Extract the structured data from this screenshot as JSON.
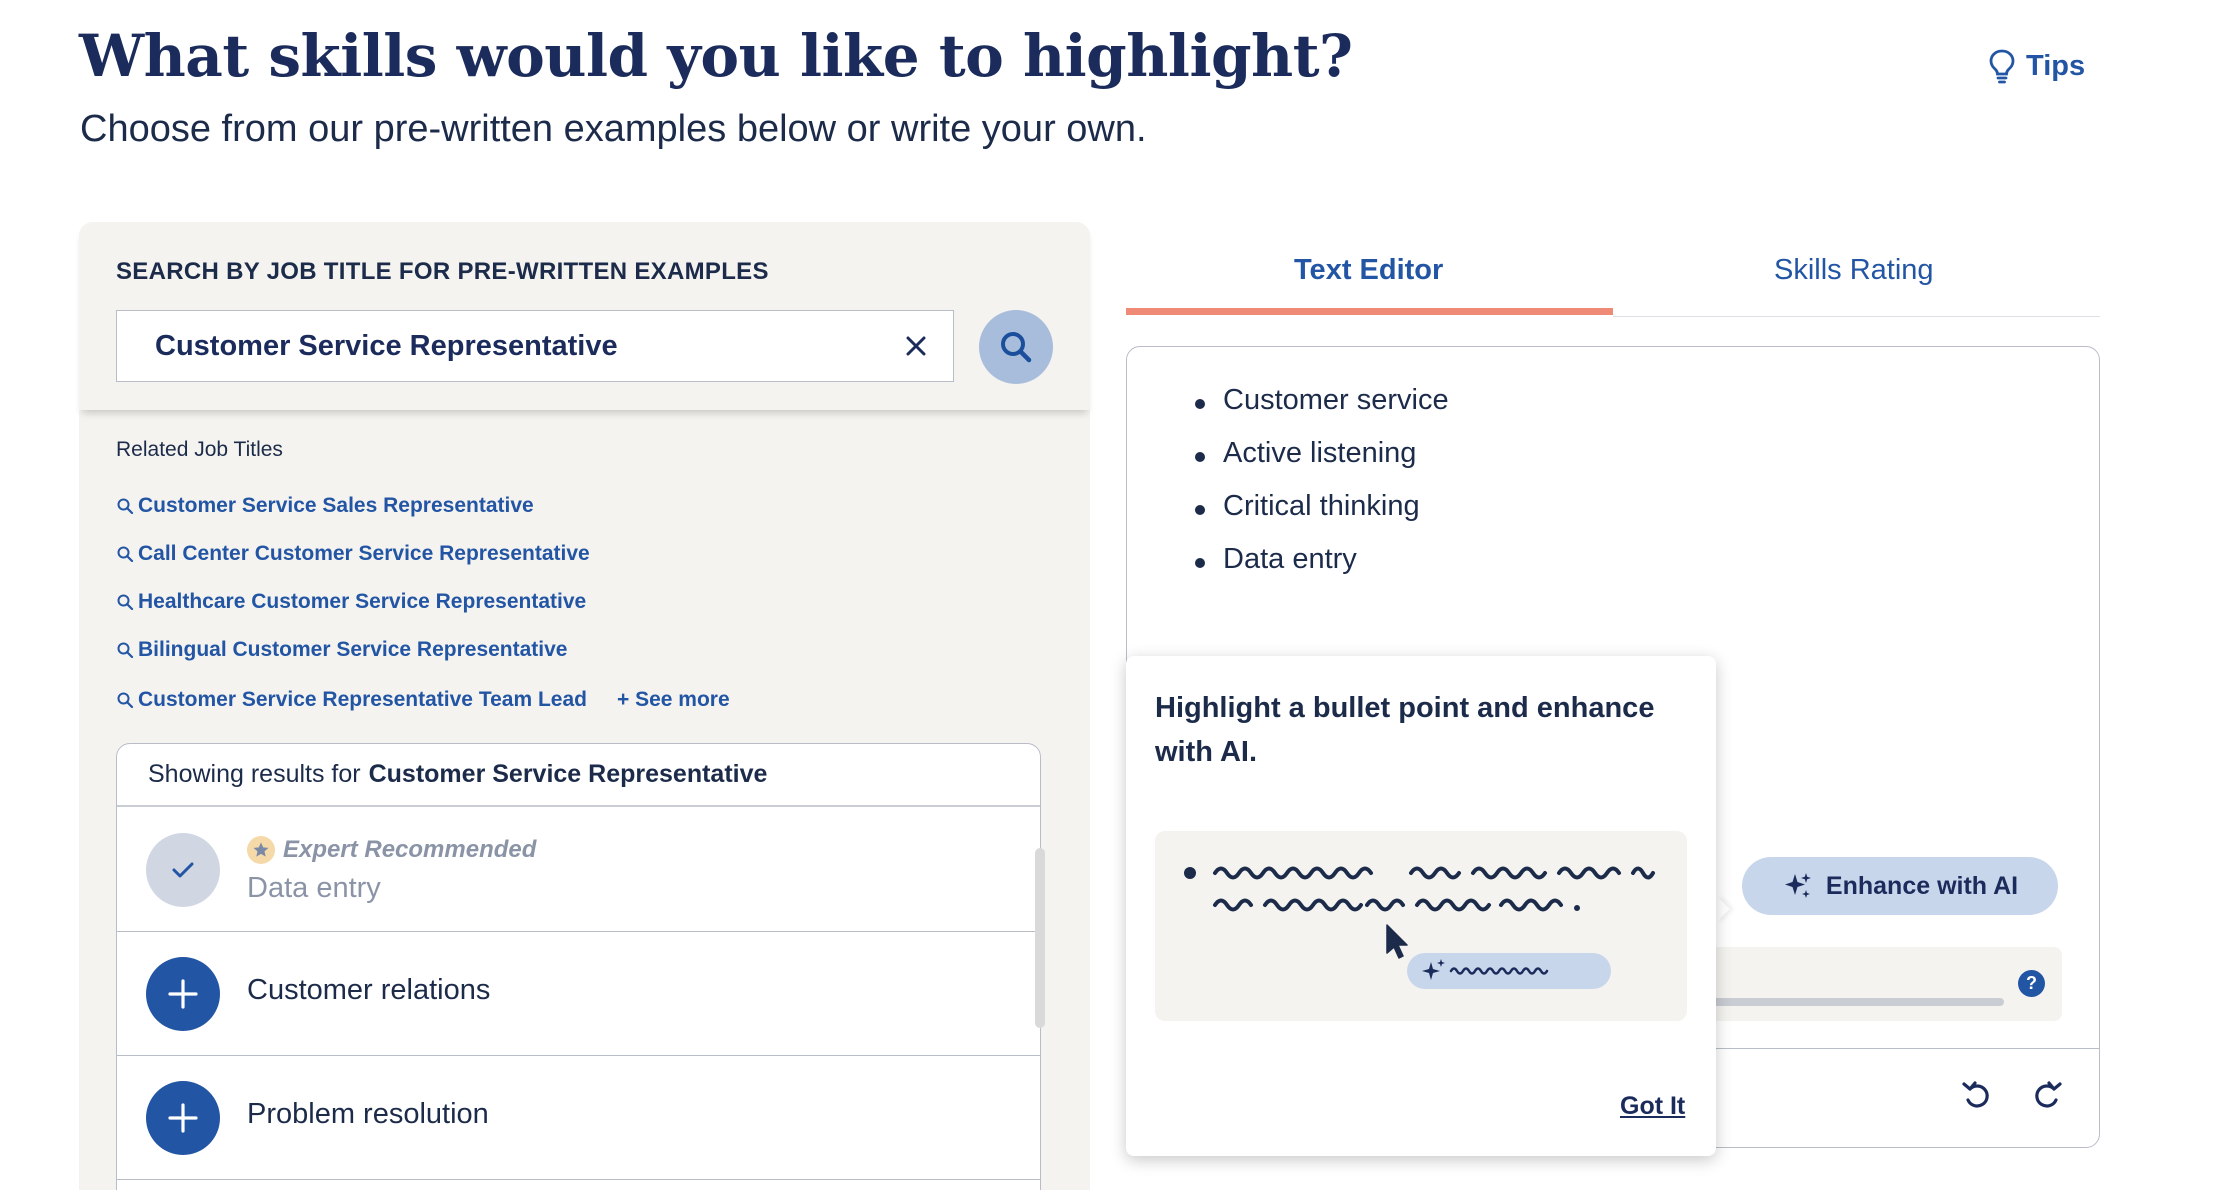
{
  "header": {
    "title": "What skills would you like to highlight?",
    "subtitle": "Choose from our pre-written examples below or write your own.",
    "tips_label": "Tips"
  },
  "search": {
    "label": "SEARCH BY JOB TITLE FOR PRE-WRITTEN EXAMPLES",
    "value": "Customer Service Representative"
  },
  "related": {
    "label": "Related Job Titles",
    "items": [
      "Customer Service Sales Representative",
      "Call Center Customer Service Representative",
      "Healthcare Customer Service Representative",
      "Bilingual Customer Service Representative",
      "Customer Service Representative Team Lead"
    ],
    "see_more": "+ See more"
  },
  "results": {
    "prefix": "Showing results for",
    "query": "Customer Service Representative",
    "items": [
      {
        "badge": "Expert Recommended",
        "label": "Data entry",
        "selected": true
      },
      {
        "label": "Customer relations",
        "selected": false
      },
      {
        "label": "Problem resolution",
        "selected": false
      }
    ]
  },
  "tabs": [
    {
      "label": "Text Editor",
      "active": true
    },
    {
      "label": "Skills Rating",
      "active": false
    }
  ],
  "editor": {
    "bullets": [
      "Customer service",
      "Active listening",
      "Critical thinking",
      "Data entry"
    ],
    "enhance_label": "Enhance with AI",
    "help": "?"
  },
  "popover": {
    "title": "Highlight a bullet point and enhance with AI.",
    "got_it": "Got It"
  },
  "colors": {
    "primary": "#2355a5",
    "navy": "#1b2b5b",
    "accent_tab": "#ee8a76",
    "panel_bg": "#f4f3ef"
  }
}
